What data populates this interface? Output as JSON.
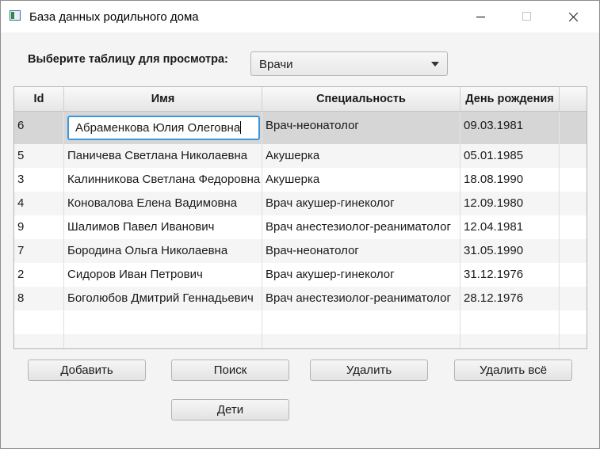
{
  "window": {
    "title": "База данных родильного дома"
  },
  "selector": {
    "label": "Выберите таблицу для просмотра:",
    "value": "Врачи"
  },
  "table": {
    "columns": [
      "Id",
      "Имя",
      "Специальность",
      "День рождения"
    ],
    "editing_value": "Абраменкова Юлия Олеговна",
    "rows": [
      {
        "id": "6",
        "name": "Абраменкова Юлия Олеговна",
        "specialty": "Врач-неонатолог",
        "birthday": "09.03.1981"
      },
      {
        "id": "5",
        "name": "Паничева Светлана Николаевна",
        "specialty": "Акушерка",
        "birthday": "05.01.1985"
      },
      {
        "id": "3",
        "name": "Калинникова Светлана Федоровна",
        "specialty": "Акушерка",
        "birthday": "18.08.1990"
      },
      {
        "id": "4",
        "name": "Коновалова Елена Вадимовна",
        "specialty": "Врач акушер-гинеколог",
        "birthday": "12.09.1980"
      },
      {
        "id": "9",
        "name": "Шалимов Павел Иванович",
        "specialty": "Врач анестезиолог-реаниматолог",
        "birthday": "12.04.1981"
      },
      {
        "id": "7",
        "name": "Бородина Ольга Николаевна",
        "specialty": "Врач-неонатолог",
        "birthday": "31.05.1990"
      },
      {
        "id": "2",
        "name": "Сидоров Иван Петрович",
        "specialty": "Врач акушер-гинеколог",
        "birthday": "31.12.1976"
      },
      {
        "id": "8",
        "name": "Боголюбов Дмитрий Геннадьевич",
        "specialty": "Врач анестезиолог-реаниматолог",
        "birthday": "28.12.1976"
      }
    ]
  },
  "buttons": {
    "add": "Добавить",
    "search": "Поиск",
    "delete": "Удалить",
    "delete_all": "Удалить всё",
    "children": "Дети"
  }
}
